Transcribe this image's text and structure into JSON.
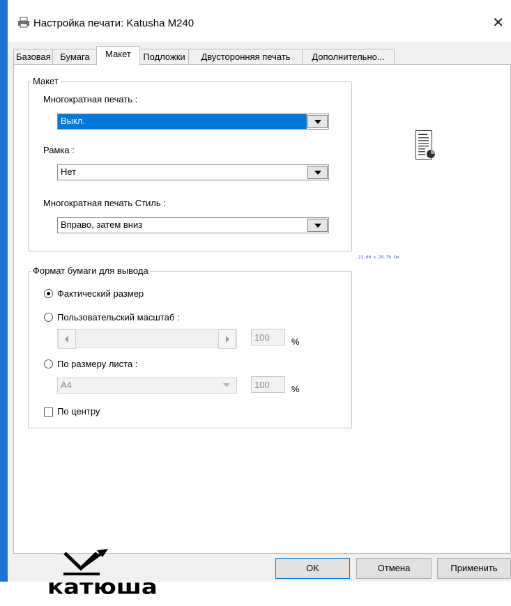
{
  "window": {
    "title": "Настройка печати: Katusha M240",
    "close": "✕"
  },
  "tabs": [
    {
      "label": "Базовая"
    },
    {
      "label": "Бумага"
    },
    {
      "label": "Макет",
      "active": true
    },
    {
      "label": "Подложки"
    },
    {
      "label": "Двусторонняя печать"
    },
    {
      "label": "Дополнительно..."
    }
  ],
  "layout_group": {
    "title": "Макет",
    "multi_print_label": "Многократная печать :",
    "multi_print_value": "Выкл.",
    "frame_label": "Рамка :",
    "frame_value": "Нет",
    "style_label": "Многократная печать Стиль :",
    "style_value": "Вправо, затем вниз"
  },
  "output_group": {
    "title": "Формат бумаги для вывода",
    "actual_size": "Фактический размер",
    "custom_scale": "Пользовательский масштаб :",
    "custom_scale_value": "100",
    "fit_to_page": "По размеру листа :",
    "paper_value": "A4",
    "fit_value": "100",
    "percent": "%",
    "center": "По центру",
    "selected": "actual_size",
    "center_checked": false
  },
  "preview": {
    "paper_size_text": "21.00 x 29.70 См"
  },
  "logo": {
    "text": "катюша"
  },
  "buttons": {
    "ok": "OK",
    "cancel": "Отмена",
    "apply": "Применить"
  },
  "colors": {
    "accent": "#0078d7",
    "window_edge": "#1e73d6"
  }
}
